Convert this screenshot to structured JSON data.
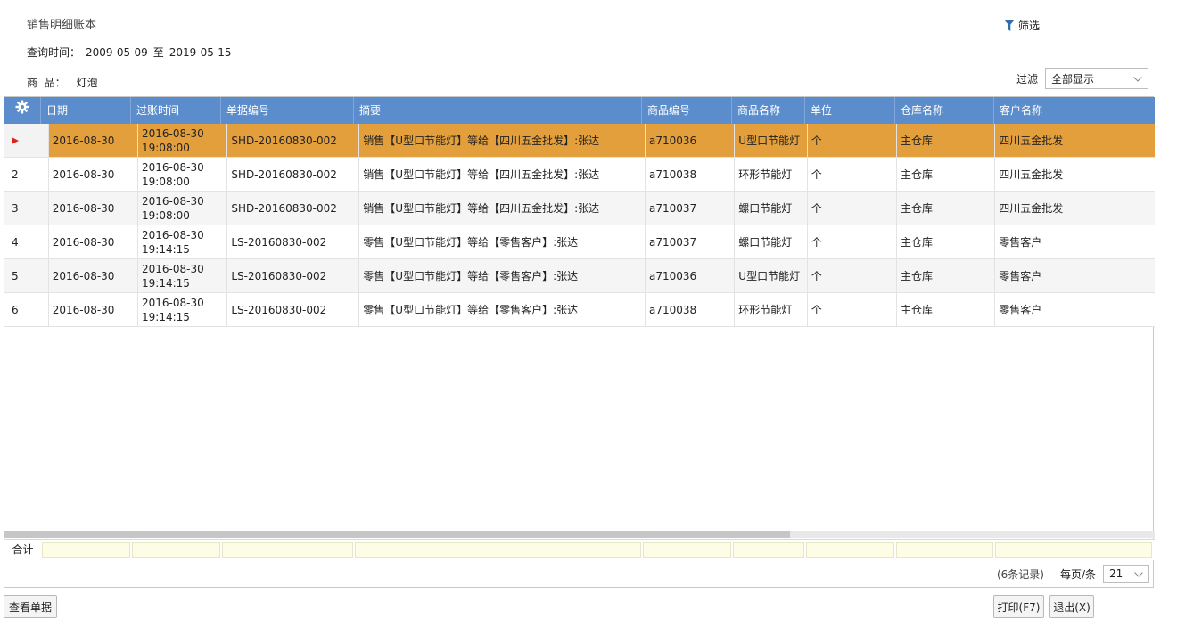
{
  "title": "销售明细账本",
  "filter_button": {
    "label": "筛选",
    "icon": "funnel-icon"
  },
  "query": {
    "label": "查询时间：",
    "from": "2009-05-09",
    "to_label": "至",
    "to": "2019-05-15"
  },
  "product": {
    "label": "商  品：",
    "value": "灯泡"
  },
  "display_filter": {
    "label": "过滤",
    "value": "全部显示"
  },
  "colors": {
    "header": "#5b8ccb",
    "selected_row": "#e39f3b",
    "row_marker": "#d9241c"
  },
  "table": {
    "columns": [
      "日期",
      "过账时间",
      "单据编号",
      "摘要",
      "商品编号",
      "商品名称",
      "单位",
      "仓库名称",
      "客户名称"
    ],
    "rows": [
      {
        "idx": "",
        "date": "2016-08-30",
        "post_date": "2016-08-30",
        "post_time": "19:08:00",
        "doc": "SHD-20160830-002",
        "summary": "销售【U型口节能灯】等给【四川五金批发】:张达",
        "code": "a710036",
        "name": "U型口节能灯",
        "unit": "个",
        "warehouse": "主仓库",
        "customer": "四川五金批发"
      },
      {
        "idx": "2",
        "date": "2016-08-30",
        "post_date": "2016-08-30",
        "post_time": "19:08:00",
        "doc": "SHD-20160830-002",
        "summary": "销售【U型口节能灯】等给【四川五金批发】:张达",
        "code": "a710038",
        "name": "环形节能灯",
        "unit": "个",
        "warehouse": "主仓库",
        "customer": "四川五金批发"
      },
      {
        "idx": "3",
        "date": "2016-08-30",
        "post_date": "2016-08-30",
        "post_time": "19:08:00",
        "doc": "SHD-20160830-002",
        "summary": "销售【U型口节能灯】等给【四川五金批发】:张达",
        "code": "a710037",
        "name": "螺口节能灯",
        "unit": "个",
        "warehouse": "主仓库",
        "customer": "四川五金批发"
      },
      {
        "idx": "4",
        "date": "2016-08-30",
        "post_date": "2016-08-30",
        "post_time": "19:14:15",
        "doc": "LS-20160830-002",
        "summary": "零售【U型口节能灯】等给【零售客户】:张达",
        "code": "a710037",
        "name": "螺口节能灯",
        "unit": "个",
        "warehouse": "主仓库",
        "customer": "零售客户"
      },
      {
        "idx": "5",
        "date": "2016-08-30",
        "post_date": "2016-08-30",
        "post_time": "19:14:15",
        "doc": "LS-20160830-002",
        "summary": "零售【U型口节能灯】等给【零售客户】:张达",
        "code": "a710036",
        "name": "U型口节能灯",
        "unit": "个",
        "warehouse": "主仓库",
        "customer": "零售客户"
      },
      {
        "idx": "6",
        "date": "2016-08-30",
        "post_date": "2016-08-30",
        "post_time": "19:14:15",
        "doc": "LS-20160830-002",
        "summary": "零售【U型口节能灯】等给【零售客户】:张达",
        "code": "a710038",
        "name": "环形节能灯",
        "unit": "个",
        "warehouse": "主仓库",
        "customer": "零售客户"
      }
    ],
    "sum_label": "合计"
  },
  "pagination": {
    "record_count": "(6条记录)",
    "per_page_label": "每页/条",
    "per_page": "21"
  },
  "buttons": {
    "view_doc": "查看单据",
    "print": "打印(F7)",
    "exit": "退出(X)"
  }
}
